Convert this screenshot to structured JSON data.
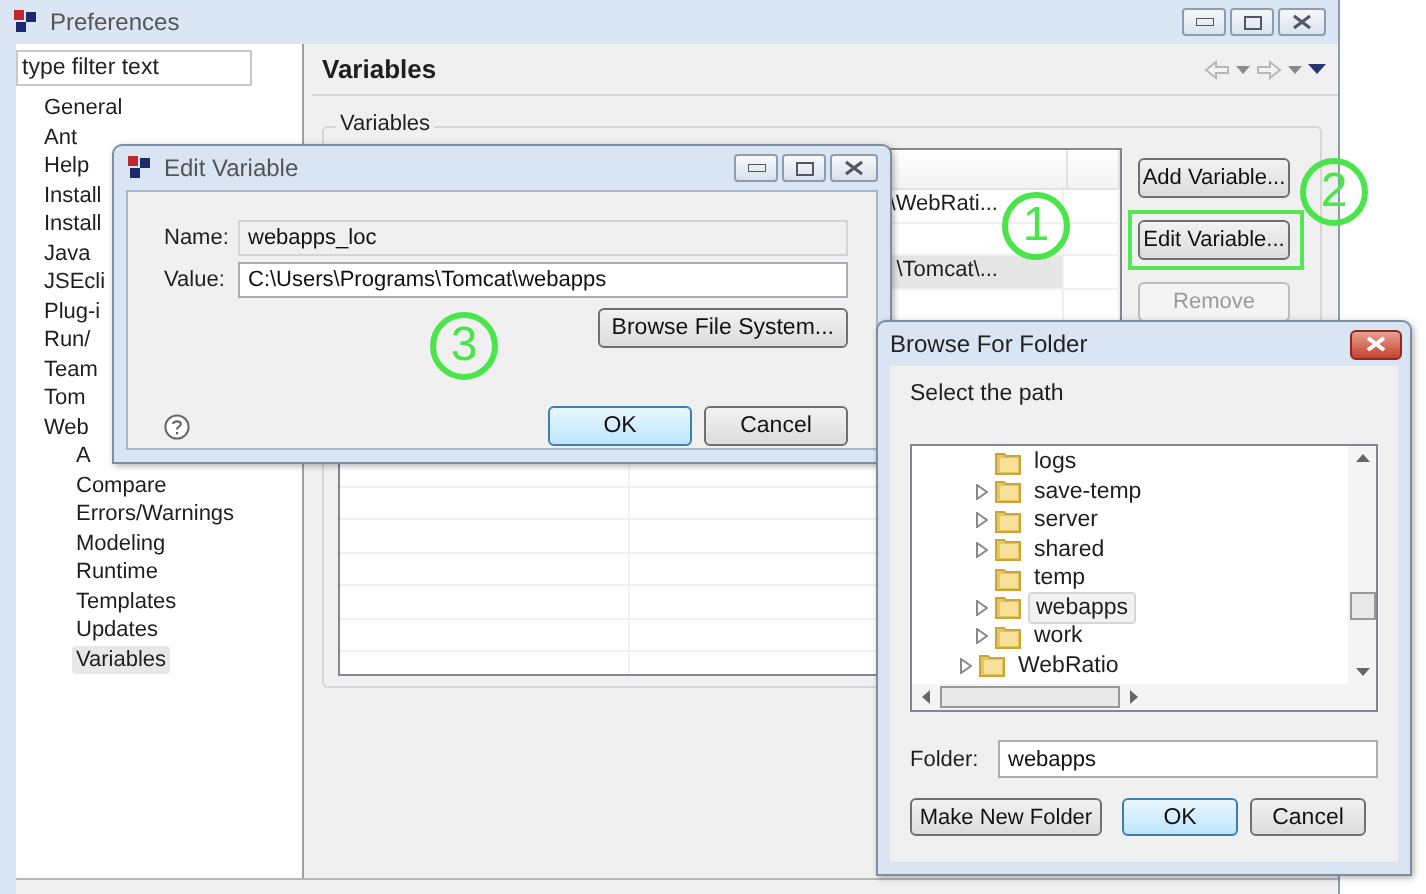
{
  "preferences": {
    "title": "Preferences",
    "filter": {
      "placeholder": "type filter text"
    },
    "tree": [
      {
        "label": "General",
        "selected": false
      },
      {
        "label": "Ant",
        "selected": false
      },
      {
        "label": "Help",
        "selected": false
      },
      {
        "label": "Install",
        "selected": false
      },
      {
        "label": "Install",
        "selected": false
      },
      {
        "label": "Java",
        "selected": false
      },
      {
        "label": "JSEcli",
        "selected": false
      },
      {
        "label": "Plug-i",
        "selected": false
      },
      {
        "label": "Run/",
        "selected": false
      },
      {
        "label": "Team",
        "selected": false
      },
      {
        "label": "Tom",
        "selected": false
      },
      {
        "label": "Web",
        "selected": false,
        "children": [
          {
            "label": "A",
            "selected": false
          },
          {
            "label": "Compare",
            "selected": false
          },
          {
            "label": "Errors/Warnings",
            "selected": false
          },
          {
            "label": "Modeling",
            "selected": false
          },
          {
            "label": "Runtime",
            "selected": false
          },
          {
            "label": "Templates",
            "selected": false
          },
          {
            "label": "Updates",
            "selected": false
          },
          {
            "label": "Variables",
            "selected": true
          }
        ]
      }
    ],
    "page_title": "Variables",
    "group_title": "Variables",
    "table": {
      "rows": [
        {
          "value": "\\WebRati...",
          "selected": false
        },
        {
          "selected": false
        },
        {
          "value": "\\Tomcat\\...",
          "selected": true
        }
      ]
    },
    "buttons": [
      {
        "label": "Add Variable...",
        "disabled": false,
        "highlighted": false
      },
      {
        "label": "Edit Variable...",
        "disabled": false,
        "highlighted": true
      },
      {
        "label": "Remove",
        "disabled": true,
        "highlighted": false
      }
    ]
  },
  "edit_variable": {
    "title": "Edit Variable",
    "fields": [
      {
        "label": "Name:",
        "value": "webapps_loc",
        "readonly": true
      },
      {
        "label": "Value:",
        "value": "C:\\Users\\Programs\\Tomcat\\webapps",
        "readonly": false
      }
    ],
    "browse_button": "Browse File System...",
    "buttons": [
      {
        "label": "OK",
        "default": true
      },
      {
        "label": "Cancel",
        "default": false
      }
    ]
  },
  "browse_for_folder": {
    "title": "Browse For Folder",
    "prompt": "Select the path",
    "folder_tree": [
      {
        "children": [
          {
            "label": "logs",
            "expandable": false,
            "selected": false
          },
          {
            "label": "save-temp",
            "expandable": true,
            "selected": false
          },
          {
            "label": "server",
            "expandable": true,
            "selected": false
          },
          {
            "label": "shared",
            "expandable": true,
            "selected": false
          },
          {
            "label": "temp",
            "expandable": false,
            "selected": false
          },
          {
            "label": "webapps",
            "expandable": true,
            "selected": true
          },
          {
            "label": "work",
            "expandable": true,
            "selected": false
          }
        ]
      },
      {
        "label": "WebRatio",
        "expandable": true,
        "selected": false
      }
    ],
    "folder_label": "Folder:",
    "folder_value": "webapps",
    "buttons": [
      {
        "label": "Make New Folder",
        "default": false
      },
      {
        "label": "OK",
        "default": true
      },
      {
        "label": "Cancel",
        "default": false
      }
    ]
  },
  "annotations": [
    {
      "text": "1"
    },
    {
      "text": "2"
    },
    {
      "text": "3"
    }
  ]
}
